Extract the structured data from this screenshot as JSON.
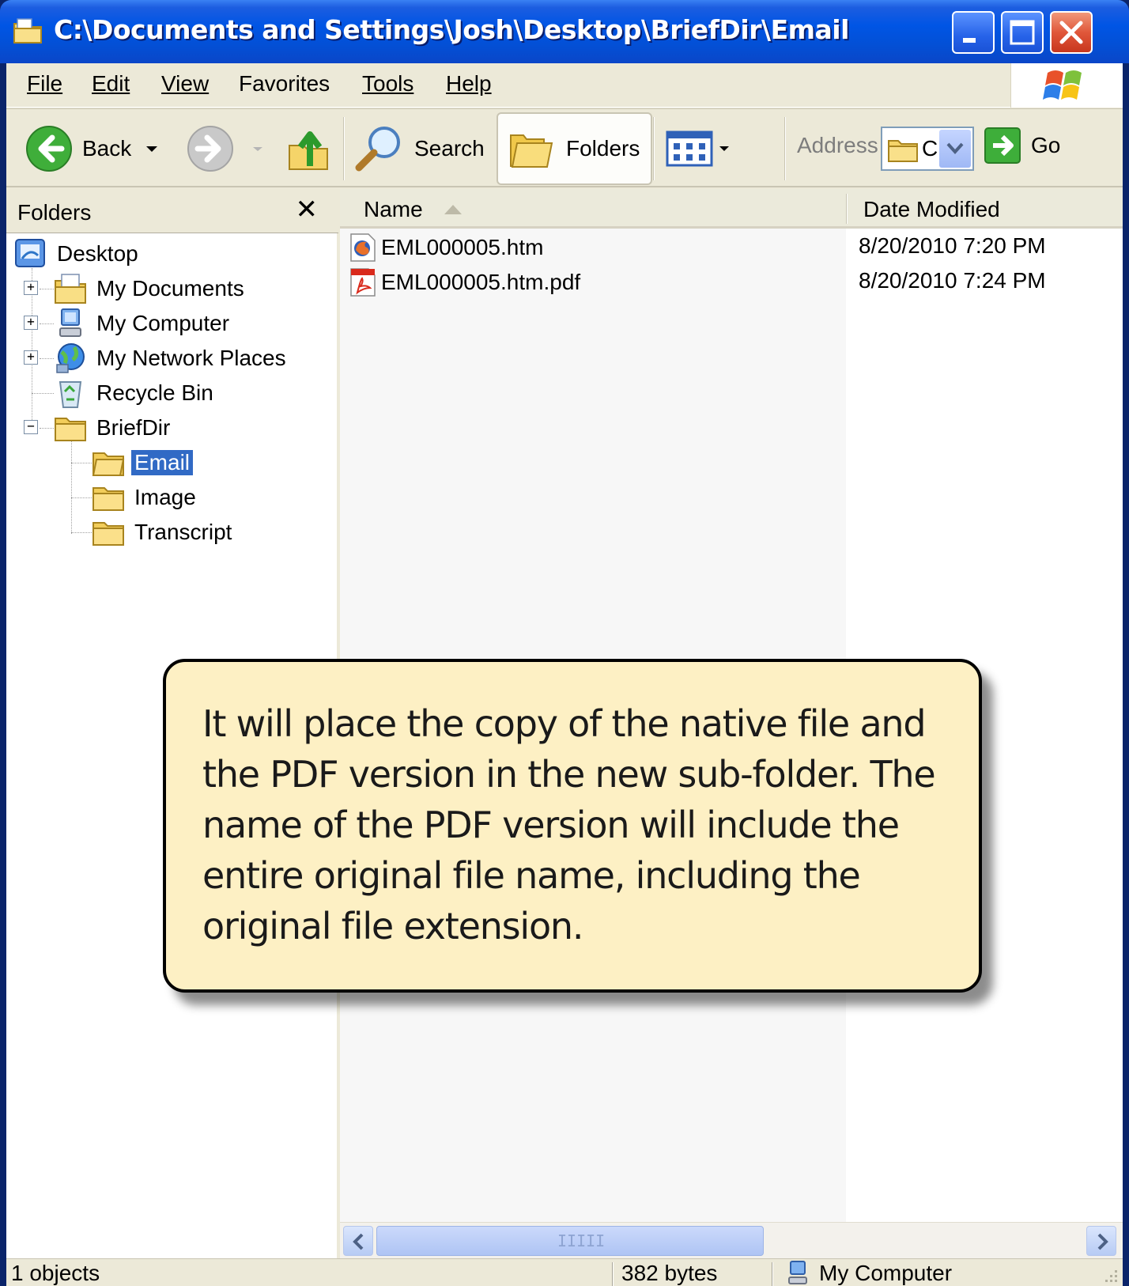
{
  "window": {
    "title": "C:\\Documents and Settings\\Josh\\Desktop\\BriefDir\\Email"
  },
  "menu": {
    "items": [
      {
        "label": "File",
        "accel": "F"
      },
      {
        "label": "Edit",
        "accel": "E"
      },
      {
        "label": "View",
        "accel": "V"
      },
      {
        "label": "Favorites",
        "accel": "a"
      },
      {
        "label": "Tools",
        "accel": "T"
      },
      {
        "label": "Help",
        "accel": "H"
      }
    ]
  },
  "toolbar": {
    "back_label": "Back",
    "search_label": "Search",
    "folders_label": "Folders",
    "address_label": "Address",
    "address_value": "C",
    "go_label": "Go"
  },
  "folders_pane": {
    "header": "Folders",
    "close_glyph": "✕",
    "tree": [
      {
        "label": "Desktop",
        "icon": "desktop-icon",
        "level": 0
      },
      {
        "label": "My Documents",
        "icon": "my-documents-icon",
        "level": 1,
        "expander": "+"
      },
      {
        "label": "My Computer",
        "icon": "my-computer-icon",
        "level": 1,
        "expander": "+"
      },
      {
        "label": "My Network Places",
        "icon": "network-places-icon",
        "level": 1,
        "expander": "+"
      },
      {
        "label": "Recycle Bin",
        "icon": "recycle-bin-icon",
        "level": 1
      },
      {
        "label": "BriefDir",
        "icon": "folder-icon",
        "level": 1,
        "expander": "−"
      },
      {
        "label": "Email",
        "icon": "folder-open-icon",
        "level": 2,
        "selected": true
      },
      {
        "label": "Image",
        "icon": "folder-icon",
        "level": 2
      },
      {
        "label": "Transcript",
        "icon": "folder-icon",
        "level": 2
      }
    ]
  },
  "file_list": {
    "columns": [
      "Name",
      "Date Modified"
    ],
    "sort_column": "Name",
    "sort_direction": "ascending",
    "rows": [
      {
        "name": "EML000005.htm",
        "date": "8/20/2010 7:20 PM",
        "icon": "firefox-html-icon"
      },
      {
        "name": "EML000005.htm.pdf",
        "date": "8/20/2010 7:24 PM",
        "icon": "pdf-icon"
      }
    ],
    "scrollbar_grip": "IIIII"
  },
  "status": {
    "objects": "1 objects",
    "size": "382 bytes",
    "zone": "My Computer"
  },
  "callout": {
    "text": "It will place the copy of the native file and the PDF version in the new sub-folder. The name of the PDF version will include the entire original file name, including the original file extension."
  },
  "colors": {
    "titlebar": "#0055e5",
    "selection": "#316ac5",
    "callout_bg": "#fdf0c4",
    "chrome": "#ece9d8"
  }
}
